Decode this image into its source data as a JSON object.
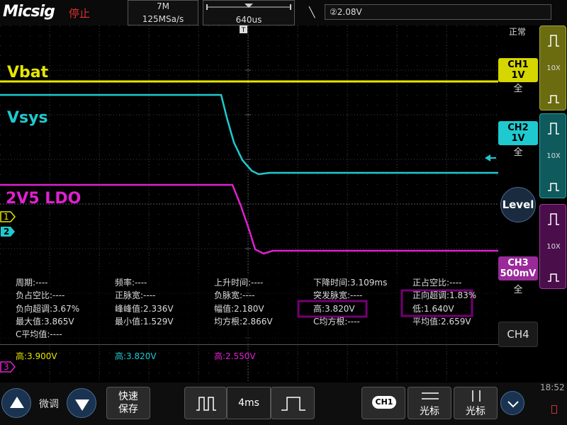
{
  "header": {
    "brand": "Micsig",
    "status": "停止",
    "memory_depth": "7M",
    "sample_rate": "125MSa/s",
    "timebase_position": "640us",
    "trigger_level": "②2.08V"
  },
  "waveforms": {
    "vbat_label": "Vbat",
    "vsys_label": "Vsys",
    "ldo_label": "2V5 LDO",
    "ch1_marker": "1",
    "ch2_marker": "2",
    "ch3_marker": "3"
  },
  "right_panel": {
    "trigger_mode": "正常",
    "ch1": {
      "name": "CH1",
      "scale": "1V",
      "coupling": "全",
      "probe": "10X"
    },
    "ch2": {
      "name": "CH2",
      "scale": "1V",
      "coupling": "全",
      "probe": "10X"
    },
    "ch3": {
      "name": "CH3",
      "scale": "500mV",
      "coupling": "全",
      "probe": "10X"
    },
    "ch4": {
      "name": "CH4"
    },
    "level_label": "Level",
    "time": "18:52"
  },
  "measurements": {
    "rows": [
      [
        "周期:----",
        "频率:----",
        "上升时间:----",
        "下降时间:3.109ms",
        "正占空比:----"
      ],
      [
        "负占空比:----",
        "正脉宽:----",
        "负脉宽:----",
        "突发脉宽:----",
        "正向超调:1.83%"
      ],
      [
        "负向超调:3.67%",
        "峰峰值:2.336V",
        "幅值:2.180V",
        "高:3.820V",
        "低:1.640V"
      ],
      [
        "最大值:3.865V",
        "最小值:1.529V",
        "均方根:2.866V",
        "C均方根:----",
        "平均值:2.659V"
      ],
      [
        "C平均值:----",
        "",
        "",
        "",
        ""
      ]
    ],
    "channel_highs": [
      "高:3.900V",
      "高:3.820V",
      "高:2.550V"
    ]
  },
  "bottom_bar": {
    "fine_adjust": "微调",
    "quick_save": "快速\n保存",
    "timebase": "4ms",
    "ch_button": "CH1",
    "cursor1": "光标",
    "cursor2": "光标"
  },
  "colors": {
    "ch1": "#e6e600",
    "ch2": "#1ecad0",
    "ch3": "#e020d0",
    "ch4": "#00aa00",
    "status_red": "#e03030",
    "highlight_box": "#ff00ff"
  }
}
